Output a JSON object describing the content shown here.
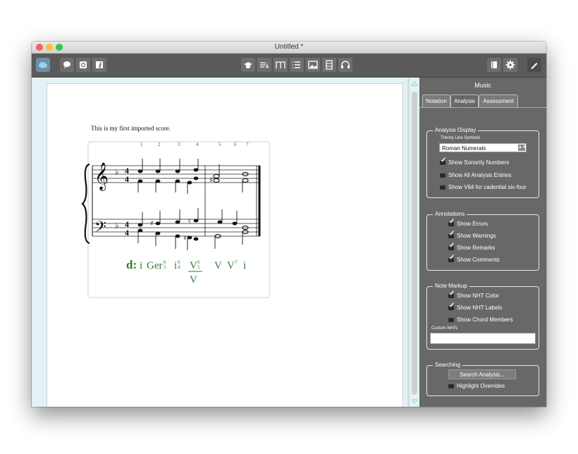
{
  "window": {
    "title": "Untitled *"
  },
  "toolbar": {
    "left_buttons": [
      "cloud-icon",
      "comment-icon",
      "email-icon",
      "facebook-icon"
    ],
    "center_buttons": [
      "graduation-cap-icon",
      "list-sort-icon",
      "text-icon",
      "list-icon",
      "image-icon",
      "film-icon",
      "headphones-icon"
    ],
    "right_buttons": [
      "book-icon",
      "gear-icon",
      "pencil-icon"
    ]
  },
  "score": {
    "caption": "This is my first imported score.",
    "measure_numbers": [
      "1",
      "2",
      "3",
      "4",
      "5",
      "6",
      "7"
    ],
    "analysis": {
      "key": "d:",
      "rn": [
        "i",
        "Ger",
        "i",
        "V",
        "V",
        "V",
        "i"
      ],
      "fig_ger": [
        "6",
        "5"
      ],
      "fig_i": [
        "6",
        "4"
      ],
      "fig_v": [
        "6",
        "5"
      ],
      "v7_fig": "7",
      "secondary": "V"
    }
  },
  "panel": {
    "title": "Music",
    "tabs": [
      "Notation",
      "Analysis",
      "Assessment"
    ],
    "analysis_display": {
      "label": "Analysis Display",
      "theory_line_label": "Theory Line Symbols",
      "theory_line_value": "Roman Numerals",
      "options": [
        {
          "label": "Show Sonority Numbers",
          "checked": true
        },
        {
          "label": "Show All Analysis Entries",
          "checked": false
        },
        {
          "label": "Show V64 for cadential six-four",
          "checked": false
        }
      ]
    },
    "annotations": {
      "label": "Annotations",
      "options": [
        {
          "label": "Show Errors",
          "checked": true
        },
        {
          "label": "Show Warnings",
          "checked": true
        },
        {
          "label": "Show Remarks",
          "checked": true
        },
        {
          "label": "Show Comments",
          "checked": true
        }
      ]
    },
    "note_markup": {
      "label": "Note Markup",
      "options": [
        {
          "label": "Show NHT Color",
          "checked": true
        },
        {
          "label": "Show NHT Labels",
          "checked": true
        },
        {
          "label": "Show Chord Members",
          "checked": false
        }
      ],
      "custom_label": "Custom NHTs",
      "custom_value": ""
    },
    "searching": {
      "label": "Searching",
      "button": "Search Analysis...",
      "options": [
        {
          "label": "Highlight Overrides",
          "checked": false
        }
      ]
    }
  },
  "colors": {
    "analysis_green": "#2e7d32",
    "panel_bg": "#686868",
    "toolbar_bg": "#5a5a5a"
  }
}
